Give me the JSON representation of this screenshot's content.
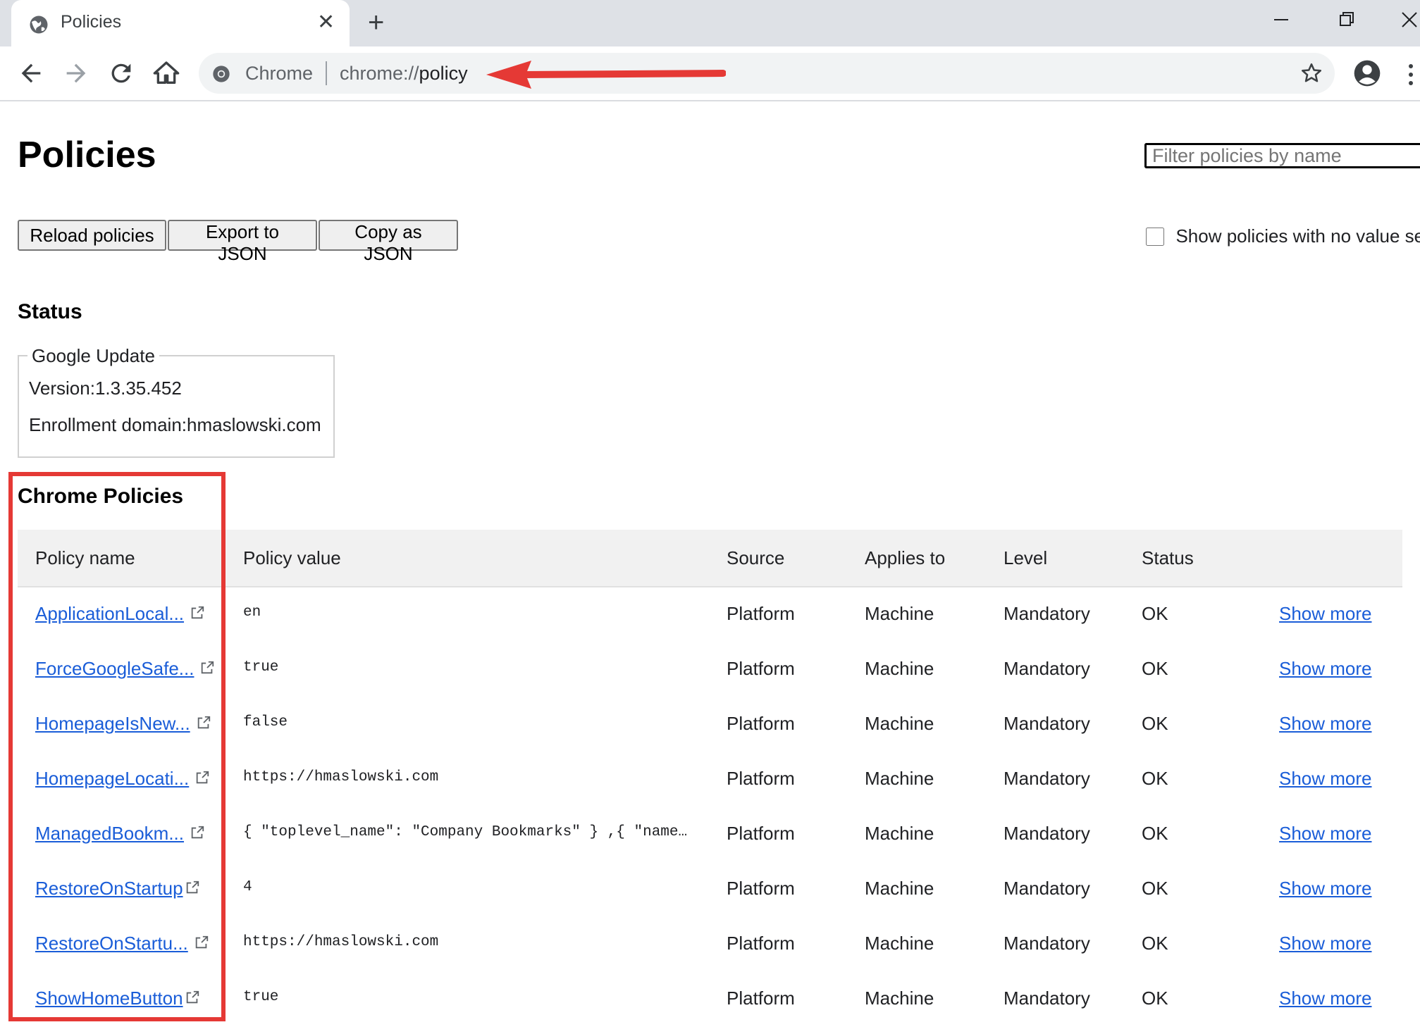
{
  "browser": {
    "tab_title": "Policies",
    "omnibox_label": "Chrome",
    "url_scheme": "chrome://",
    "url_path": "policy"
  },
  "page": {
    "title": "Policies",
    "filter_placeholder": "Filter policies by name",
    "buttons": {
      "reload": "Reload policies",
      "export": "Export to JSON",
      "copy": "Copy as JSON"
    },
    "show_unset_label": "Show policies with no value se"
  },
  "status": {
    "heading": "Status",
    "box_title": "Google Update",
    "version": "Version:1.3.35.452",
    "enrollment": "Enrollment domain:hmaslowski.com"
  },
  "chrome_policies": {
    "heading": "Chrome Policies",
    "columns": [
      "Policy name",
      "Policy value",
      "Source",
      "Applies to",
      "Level",
      "Status"
    ],
    "rows": [
      {
        "name": "ApplicationLocal...",
        "value": "en",
        "source": "Platform",
        "applies": "Machine",
        "level": "Mandatory",
        "status": "OK",
        "action": "Show more"
      },
      {
        "name": "ForceGoogleSafe...",
        "value": "true",
        "source": "Platform",
        "applies": "Machine",
        "level": "Mandatory",
        "status": "OK",
        "action": "Show more"
      },
      {
        "name": "HomepageIsNew...",
        "value": "false",
        "source": "Platform",
        "applies": "Machine",
        "level": "Mandatory",
        "status": "OK",
        "action": "Show more"
      },
      {
        "name": "HomepageLocati...",
        "value": "https://hmaslowski.com",
        "source": "Platform",
        "applies": "Machine",
        "level": "Mandatory",
        "status": "OK",
        "action": "Show more"
      },
      {
        "name": "ManagedBookm...",
        "value": "{ \"toplevel_name\": \"Company Bookmarks\" } ,{ \"name\": \"M...",
        "source": "Platform",
        "applies": "Machine",
        "level": "Mandatory",
        "status": "OK",
        "action": "Show more"
      },
      {
        "name": "RestoreOnStartup",
        "value": "4",
        "source": "Platform",
        "applies": "Machine",
        "level": "Mandatory",
        "status": "OK",
        "action": "Show more"
      },
      {
        "name": "RestoreOnStartu...",
        "value": "https://hmaslowski.com",
        "source": "Platform",
        "applies": "Machine",
        "level": "Mandatory",
        "status": "OK",
        "action": "Show more"
      },
      {
        "name": "ShowHomeButton",
        "value": "true",
        "source": "Platform",
        "applies": "Machine",
        "level": "Mandatory",
        "status": "OK",
        "action": "Show more"
      }
    ]
  },
  "colors": {
    "link": "#1a5dd8",
    "annotation_red": "#e53935",
    "header_bg": "#f1f1f1"
  },
  "icons": [
    "globe-icon",
    "close-icon",
    "plus-icon",
    "minimize-icon",
    "restore-icon",
    "window-close-icon",
    "back-arrow-icon",
    "forward-arrow-icon",
    "reload-icon",
    "home-icon",
    "chrome-icon",
    "star-icon",
    "profile-icon",
    "kebab-menu-icon",
    "external-link-icon",
    "red-arrow-annotation"
  ]
}
